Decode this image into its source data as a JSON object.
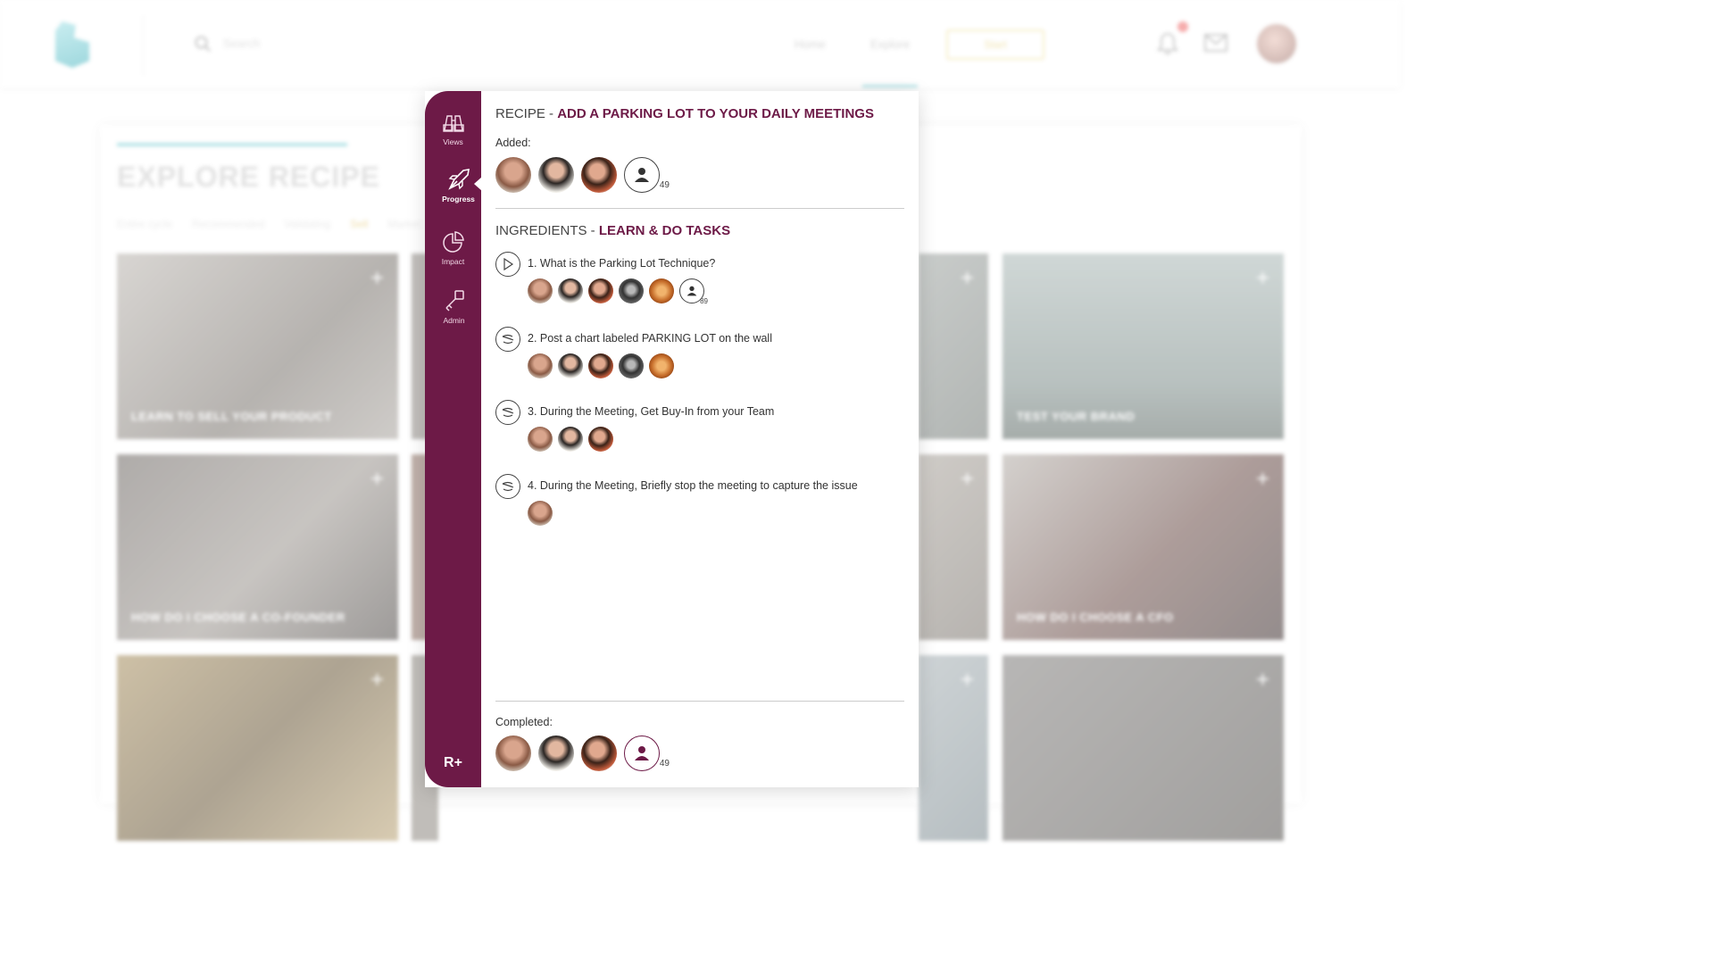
{
  "background": {
    "search_placeholder": "Search",
    "nav": {
      "home": "Home",
      "explore": "Explore",
      "cta": "Start"
    },
    "page_title": "EXPLORE RECIPE",
    "filters": [
      "Entire cycle",
      "Recommended",
      "Validating",
      "Sell",
      "Market"
    ],
    "tiles": [
      {
        "label": "LEARN TO SELL YOUR PRODUCT"
      },
      {
        "label": "TEST YOUR BRAND"
      },
      {
        "label": "HOW DO I CHOOSE A CO-FOUNDER"
      },
      {
        "label": "HOW DO I CHOOSE A CFO"
      }
    ],
    "colors": {
      "accent": "#7fd0d6",
      "highlight": "#e3c66a"
    }
  },
  "modal": {
    "side_nav": [
      {
        "label": "Views",
        "icon": "binoculars-icon"
      },
      {
        "label": "Progress",
        "icon": "rocket-icon",
        "active": true
      },
      {
        "label": "Impact",
        "icon": "pie-chart-icon"
      },
      {
        "label": "Admin",
        "icon": "key-icon"
      }
    ],
    "brand": "R+",
    "recipe_prefix": "RECIPE - ",
    "recipe_name": "ADD A PARKING LOT TO YOUR DAILY MEETINGS",
    "added_label": "Added:",
    "added_count": "49",
    "ingredients_prefix": "INGREDIENTS - ",
    "ingredients_name": "LEARN & DO TASKS",
    "tasks": [
      {
        "text": "1. What is the Parking Lot Technique?",
        "icon": "play-icon",
        "extra_count": "89"
      },
      {
        "text": "2. Post a chart labeled PARKING LOT on the wall",
        "icon": "task-icon"
      },
      {
        "text": "3. During the Meeting, Get Buy-In from your Team",
        "icon": "task-icon"
      },
      {
        "text": "4. During the Meeting, Briefly stop the meeting to capture the issue",
        "icon": "task-icon"
      }
    ],
    "completed_label": "Completed:",
    "completed_count": "49",
    "colors": {
      "brand": "#6d1a47"
    }
  }
}
